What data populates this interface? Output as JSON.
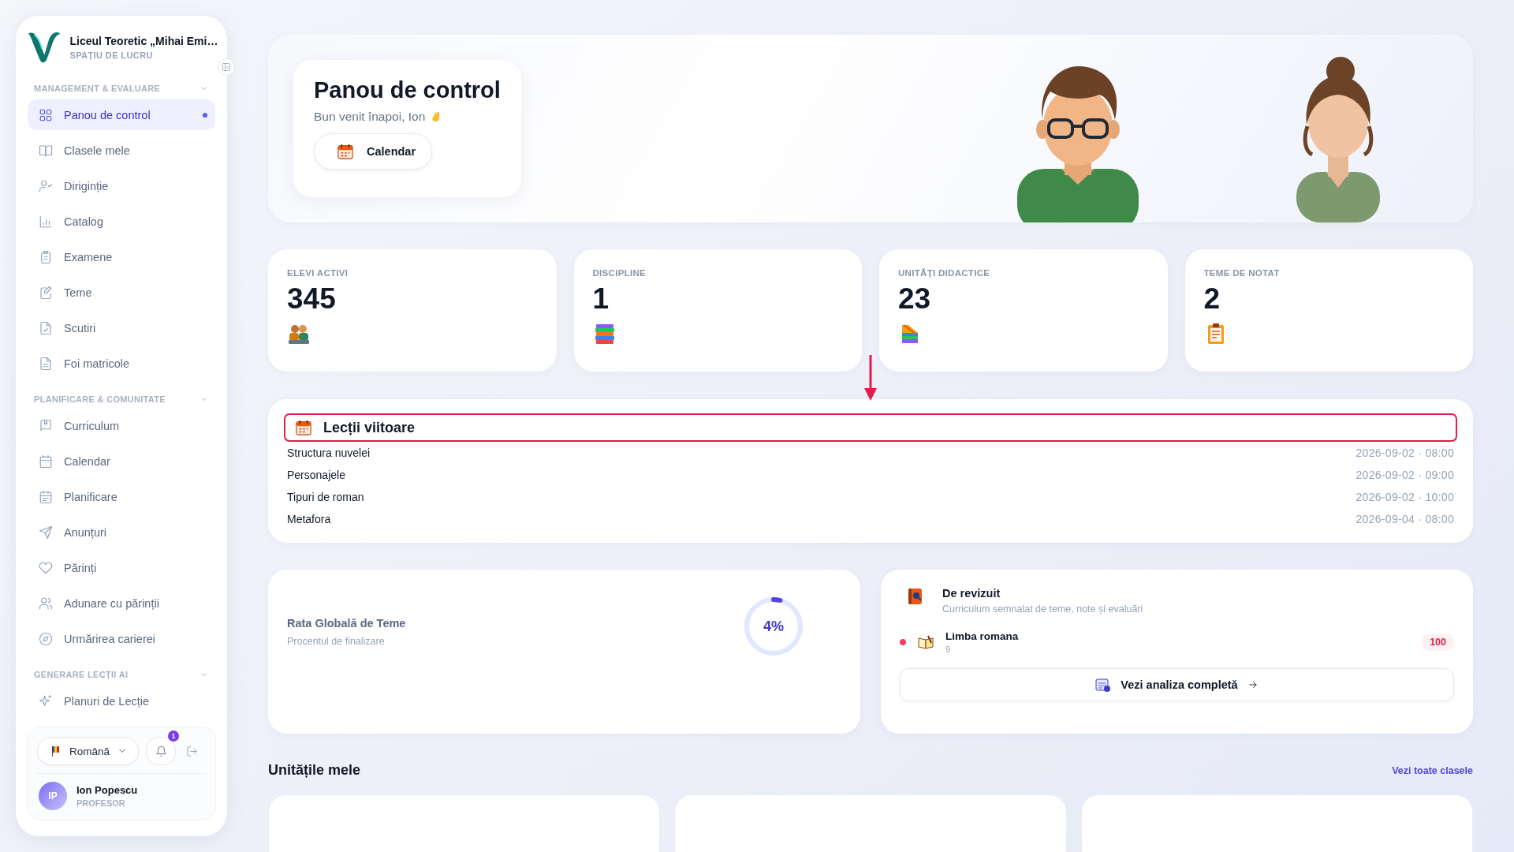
{
  "sidebar": {
    "school": "Liceul Teoretic „Mihai Emi…",
    "subtitle": "SPAȚIU DE LUCRU",
    "sections": [
      {
        "title": "MANAGEMENT & EVALUARE",
        "expanded": true,
        "items": [
          {
            "label": "Panou de control",
            "kind": "grid",
            "selected": true
          },
          {
            "label": "Clasele mele",
            "kind": "book",
            "selected": false
          },
          {
            "label": "Diriginție",
            "kind": "usercheck",
            "selected": false
          },
          {
            "label": "Catalog",
            "kind": "chart",
            "selected": false
          },
          {
            "label": "Examene",
            "kind": "clipboard",
            "selected": false
          },
          {
            "label": "Teme",
            "kind": "edit",
            "selected": false
          },
          {
            "label": "Scutiri",
            "kind": "filecheck",
            "selected": false
          },
          {
            "label": "Foi matricole",
            "kind": "file",
            "selected": false
          }
        ]
      },
      {
        "title": "PLANIFICARE & COMUNITATE",
        "expanded": true,
        "items": [
          {
            "label": "Curriculum",
            "kind": "bookmark",
            "selected": false
          },
          {
            "label": "Calendar",
            "kind": "calendar",
            "selected": false
          },
          {
            "label": "Planificare",
            "kind": "calendarlist",
            "selected": false
          },
          {
            "label": "Anunțuri",
            "kind": "send",
            "selected": false
          },
          {
            "label": "Părinți",
            "kind": "heart",
            "selected": false
          },
          {
            "label": "Adunare cu părinții",
            "kind": "users",
            "selected": false
          },
          {
            "label": "Urmărirea carierei",
            "kind": "compass",
            "selected": false
          }
        ]
      },
      {
        "title": "GENERARE LECȚII AI",
        "expanded": true,
        "items": [
          {
            "label": "Planuri de Lecție",
            "kind": "sparkles",
            "selected": false
          }
        ]
      }
    ]
  },
  "footer": {
    "language": "Română",
    "notifications": "1",
    "user": {
      "initials": "IP",
      "name": "Ion Popescu",
      "role": "PROFESOR"
    }
  },
  "hero": {
    "title": "Panou de control",
    "subtitle": "Bun venit înapoi, Ion",
    "button": "Calendar"
  },
  "stats": [
    {
      "label": "ELEVI ACTIVI",
      "value": "345",
      "kind": "students"
    },
    {
      "label": "DISCIPLINE",
      "value": "1",
      "kind": "books"
    },
    {
      "label": "UNITĂȚI DIDACTICE",
      "value": "23",
      "kind": "ruler"
    },
    {
      "label": "TEME DE NOTAT",
      "value": "2",
      "kind": "clipboard"
    }
  ],
  "lessons": {
    "title": "Lecții viitoare",
    "highlighted": true,
    "rows": [
      {
        "name": "Structura nuvelei",
        "when": "2026-09-02 · 08:00"
      },
      {
        "name": "Personajele",
        "when": "2026-09-02 · 09:00"
      },
      {
        "name": "Tipuri de roman",
        "when": "2026-09-02 · 10:00"
      },
      {
        "name": "Metafora",
        "when": "2026-09-04 · 08:00"
      }
    ]
  },
  "rate": {
    "title": "Rata Globală de Teme",
    "subtitle": "Procentul de finalizare",
    "level": 0.04,
    "reading": "4%"
  },
  "review": {
    "title": "De revizuit",
    "subtitle": "Curriculum semnalat de teme, note și evaluări",
    "items": [
      {
        "name": "Limba romana",
        "detail": "9",
        "count": "100",
        "color": "#f43f5e"
      }
    ],
    "button": "Vezi analiza completă"
  },
  "units": {
    "title": "Unitățile mele",
    "link": "Vezi toate clasele",
    "cards": [
      {
        "kind": "card"
      },
      {
        "kind": "card"
      },
      {
        "kind": "card"
      }
    ]
  }
}
